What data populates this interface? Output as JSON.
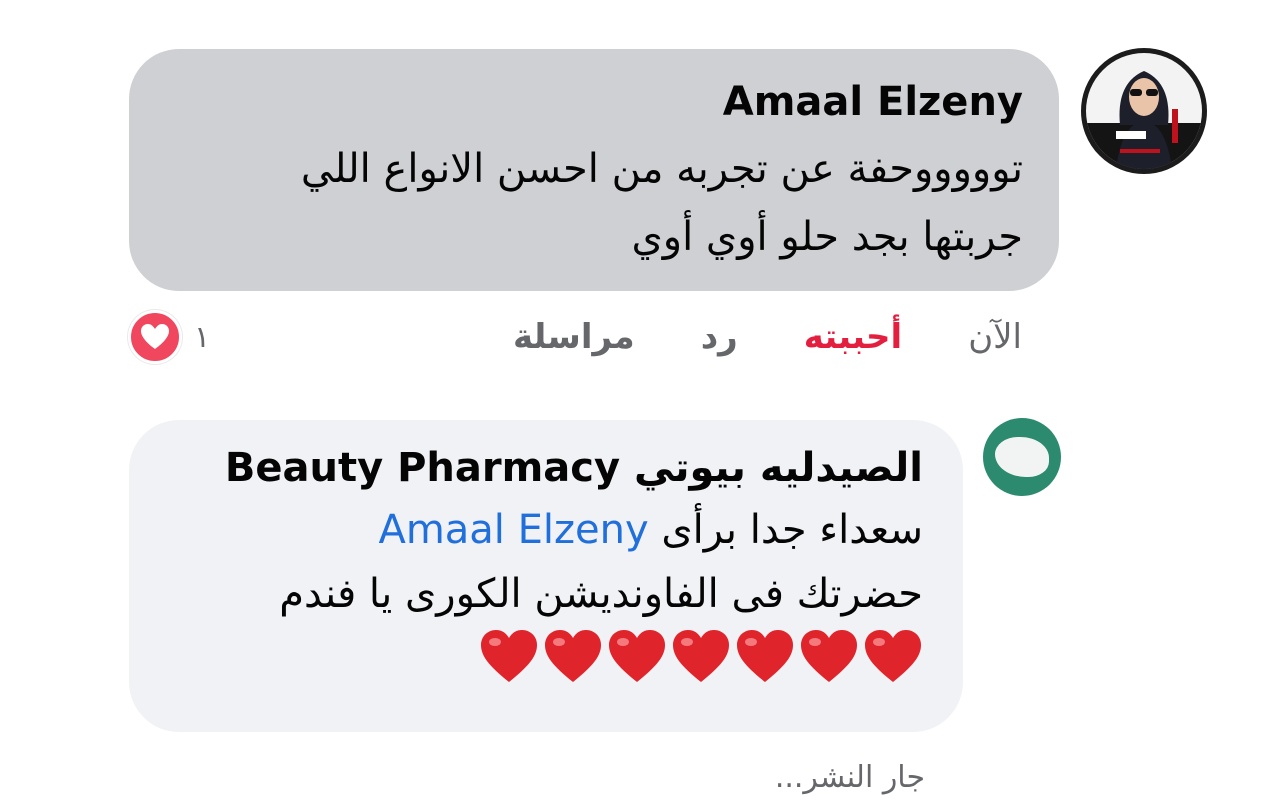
{
  "comments": [
    {
      "author": "Amaal Elzeny",
      "lines": [
        "توووووحفة عن تجربه من احسن الانواع اللي",
        "جربتها بجد حلو أوي أوي"
      ],
      "actions": {
        "time": "الآن",
        "like": "أحببته",
        "reply": "رد",
        "message": "مراسلة"
      },
      "reaction": {
        "icon": "heart-icon",
        "count": "١",
        "color": "#f0475f"
      }
    },
    {
      "author": "الصيدليه بيوتي Beauty Pharmacy",
      "line1_prefix": "سعداء جدا برأى",
      "mention": "Amaal Elzeny",
      "line2": "حضرتك فى الفاونديشن الكورى يا فندم",
      "hearts": [
        "red-heart-emoji",
        "red-heart-emoji",
        "red-heart-emoji",
        "red-heart-emoji",
        "red-heart-emoji",
        "red-heart-emoji",
        "red-heart-emoji"
      ],
      "status": "جار النشر..."
    }
  ],
  "colors": {
    "bubble_primary": "#ced0d4",
    "bubble_secondary": "#f0f2f5",
    "like_active": "#e41e3f",
    "mention": "#216fdb",
    "muted_text": "#65676b"
  }
}
